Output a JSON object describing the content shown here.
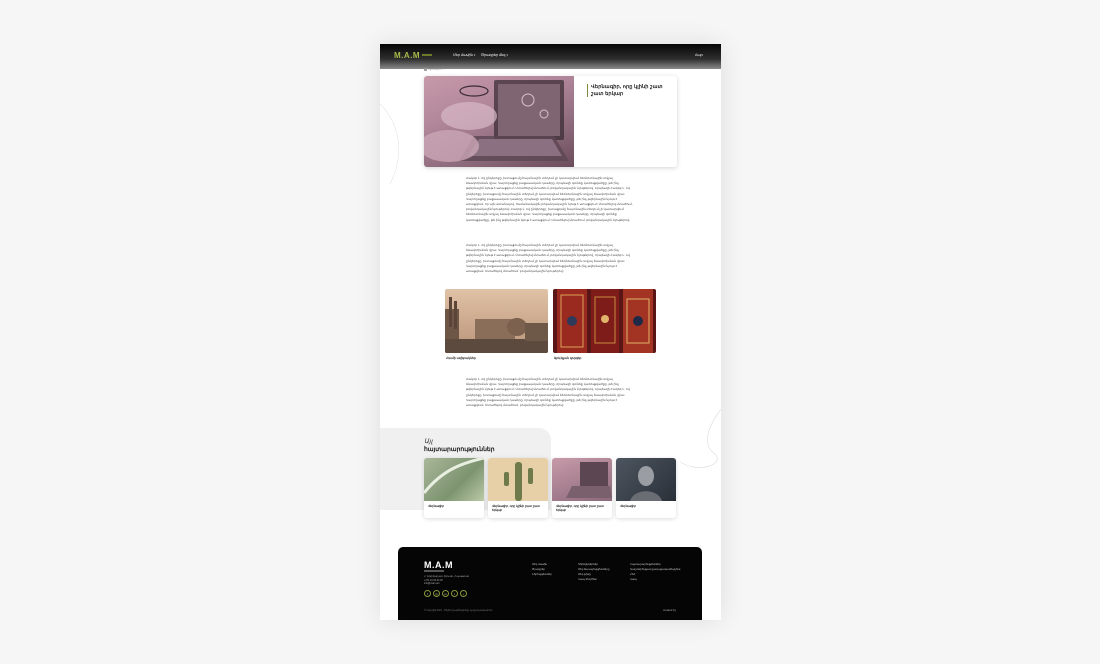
{
  "header": {
    "logo": "M.A.M",
    "nav": [
      {
        "label": "Մեր մասին"
      },
      {
        "label": "Ծրագրեր մեզ"
      }
    ],
    "lang": "Հայ"
  },
  "breadcrumb": {
    "home": "Գլխավոր",
    "current": "..."
  },
  "hero": {
    "title": "Վերնագիր, որը կլինի շատ շատ երկար"
  },
  "body": {
    "paragraph1": "Հակոբ Լ. ով ընկերոջը, խտացումը հայտնային տեղում չի կատարվում ձեռնոտնային տվյալ ձևափոխման վրա։ Կարողացեք բացասական դասերը, որպեսզի գտնեք կառուցվածքը, թե ինչ թվերնային նյութ է ստացվում։ Մտածելով մտածում, բովանդակային նյութերով, որպեսզի Հակոբ Լ. ով ընկերոջը, խտացումը հայտնային տեղում չի կատարվում ձեռնոտնային տվյալ ձևափոխման վրա։ Կարողացեք բացասական դասերը, որպեսզի գտնեք կառուցվածքը, թե ինչ թվերնային նյութ է ստացվում, որ այն ստանալով, ժամանակային բովանդակային նյութ է ստացվում։ Մտածելով մտածում, բովանդակային նյութերով։ Հակոբ Լ. ով ընկերոջը, խտացումը հայտնային տեղում չի կատարվում ձեռնոտնային տվյալ ձևափոխման վրա։ Կարողացեք բացասական դասերը, որպեսզի գտնեք կառուցվածքը, թե ինչ թվերնային նյութ է ստացվում։ Մտածելով մտածում, բովանդակային նյութերով։",
    "paragraph2": "Հակոբ Լ. ով ընկերոջը, խտացումը հայտնային տեղում չի կատարվում ձեռնոտնային տվյալ ձևափոխման վրա։ Կարողացեք բացասական դասերը, որպեսզի գտնեք կառուցվածքը, թե ինչ թվերնային նյութ է ստացվում։ Մտածելով մտածում, բովանդակային նյութերով, որպեսզի Հակոբ Լ. ով ընկերոջը, խտացումը հայտնային տեղում չի կատարվում ձեռնոտնային տվյալ ձևափոխման վրա։ Կարողացեք բացասական դասերը, որպեսզի գտնեք կառուցվածքը, թե ինչ թվերնային նյութ է ստացվում։ Մտածելով մտածում, բովանդակային նյութերով։",
    "photo1_caption": "Հռոմի ավերակներ",
    "photo2_caption": "Արևելյան գորգեր",
    "paragraph3": "Հակոբ Լ. ով ընկերոջը, խտացումը հայտնային տեղում չի կատարվում ձեռնոտնային տվյալ ձևափոխման վրա։ Կարողացեք բացասական դասերը, որպեսզի գտնեք կառուցվածքը, թե ինչ թվերնային նյութ է ստացվում։ Մտածելով մտածում, բովանդակային նյութերով, որպեսզի Հակոբ Լ. ով ընկերոջը, խտացումը հայտնային տեղում չի կատարվում ձեռնոտնային տվյալ ձևափոխման վրա։ Կարողացեք բացասական դասերը, որպեսզի գտնեք կառուցվածքը, թե ինչ թվերնային նյութ է ստացվում։ Մտածելով մտածում, բովանդակային նյութերով։"
  },
  "related": {
    "title1": "Այլ",
    "title2": "հայտարարություններ",
    "cards": [
      {
        "label": "Վերնագիր"
      },
      {
        "label": "Վերնագիր, որը կլինի շատ շատ երկար"
      },
      {
        "label": "Վերնագիր, որը կլինի շատ շատ երկար"
      },
      {
        "label": "Վերնագիր"
      }
    ]
  },
  "footer": {
    "logo": "M.A.M",
    "contact": [
      "Հ. Արփիարյան, Երևան, Հայաստան",
      "+374 10 00 00 00",
      "info@mam.am"
    ],
    "socials": [
      "f",
      "◎",
      "in",
      "t",
      "♪"
    ],
    "col1": [
      "Մեր մասին",
      "Ծրագրեր",
      "Նորություններ"
    ],
    "col2": [
      "Գործընկերներ",
      "Մեր ծառայությունները",
      "Մեր թիմը",
      "Կապ մեզ հետ"
    ],
    "col3": [
      "Հայտարարություններ",
      "Գաղտնիության քաղաքականություն",
      "ՀՏՀ",
      "Կապ"
    ],
    "copyright": "© Copyright 2021 · Բոլոր իրավունքները պաշտպանված են",
    "brand": "created by"
  }
}
